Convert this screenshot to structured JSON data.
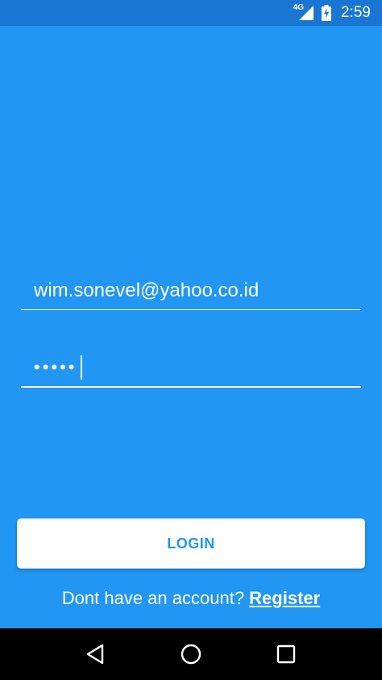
{
  "status_bar": {
    "network": "4G",
    "time": "2:59",
    "icons": [
      "signal-icon",
      "battery-charging-icon"
    ]
  },
  "login_form": {
    "email_value": "wim.sonevel@yahoo.co.id",
    "password_masked": "•••••",
    "login_label": "LOGIN",
    "register_prompt": "Dont have an account? ",
    "register_link": "Register"
  },
  "nav_bar": {
    "icons": [
      "back-icon",
      "home-icon",
      "recents-icon"
    ]
  },
  "colors": {
    "primary": "#2196F3",
    "status_bar": "#1976D2",
    "nav_bar": "#000000",
    "button_background": "#FFFFFF"
  }
}
